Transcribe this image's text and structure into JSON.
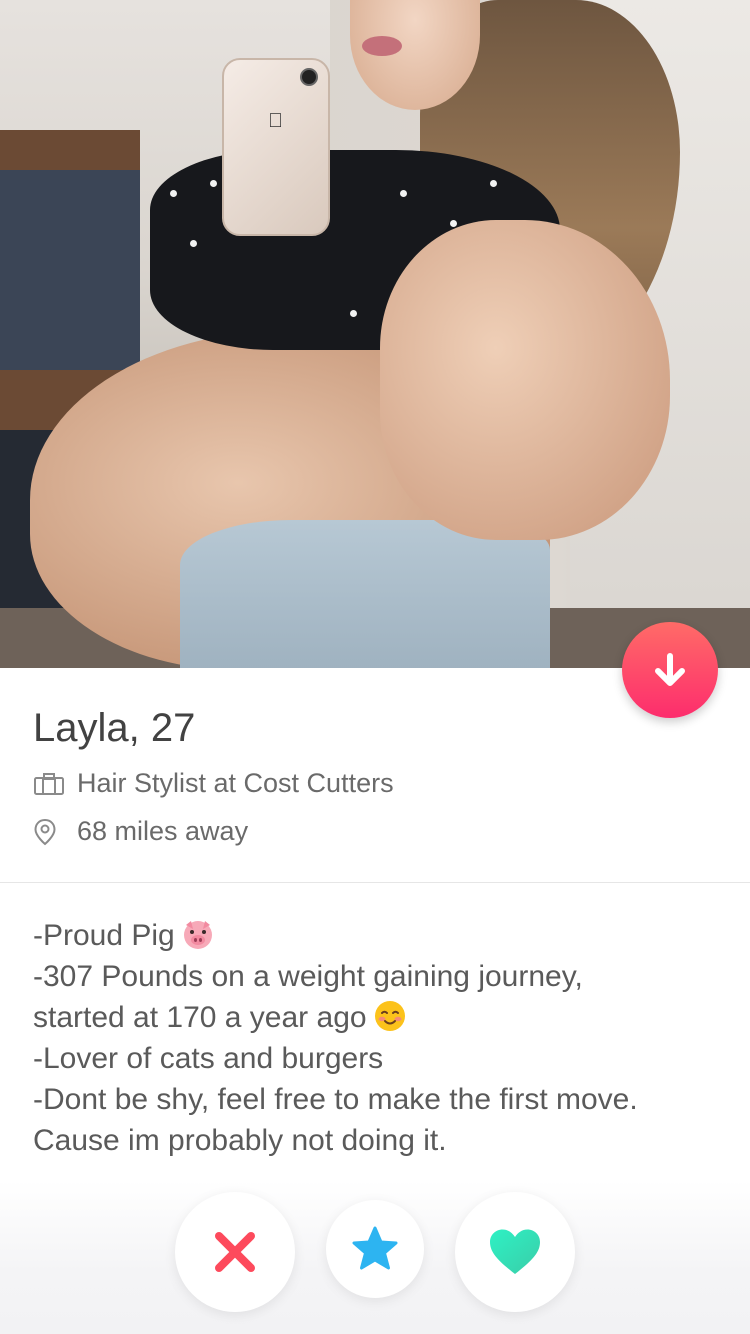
{
  "profile": {
    "name": "Layla",
    "age_text": ", 27",
    "job": "Hair Stylist at Cost Cutters",
    "distance": "68 miles away"
  },
  "bio": {
    "lines": [
      "-Proud Pig",
      "-307 Pounds on a weight gaining journey,",
      "started at 170 a year ago",
      "-Lover of cats and burgers",
      "-Dont be shy, feel free to make the first move.",
      "Cause im probably not doing it."
    ]
  },
  "icons": {
    "collapse": "arrow-down-icon",
    "job": "briefcase-icon",
    "location": "location-pin-icon",
    "nope": "close-icon",
    "super_like": "star-icon",
    "like": "heart-icon",
    "emoji_1": "pig-face-emoji",
    "emoji_2": "smiling-face-emoji"
  },
  "colors": {
    "fab_gradient_top": "#ff6b67",
    "fab_gradient_bottom": "#fd2d6d",
    "nope": "#fd4a5c",
    "star": "#2db4f1",
    "like": "#3ee7bd"
  }
}
